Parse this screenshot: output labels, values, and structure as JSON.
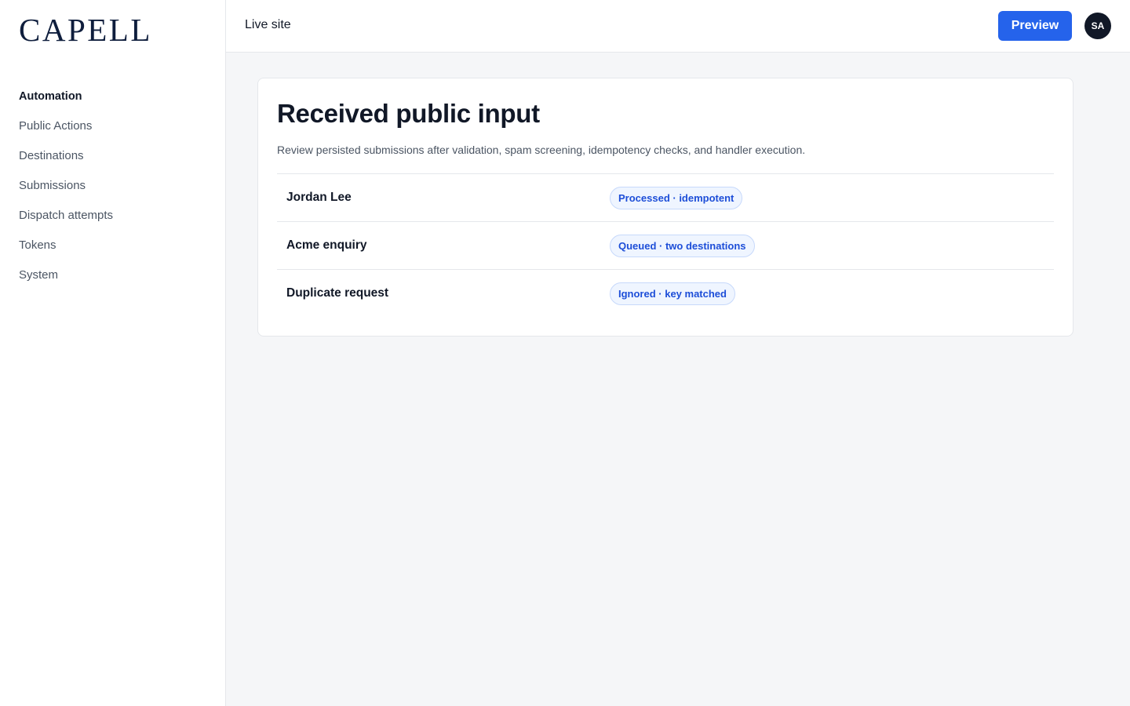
{
  "brand": {
    "logo_text": "CAPELL",
    "colors": {
      "logo": "#0f1e3d",
      "accent": "#2563eb"
    }
  },
  "sidebar": {
    "items": [
      {
        "label": "Automation",
        "active": true
      },
      {
        "label": "Public Actions"
      },
      {
        "label": "Destinations"
      },
      {
        "label": "Submissions"
      },
      {
        "label": "Dispatch attempts"
      },
      {
        "label": "Tokens"
      },
      {
        "label": "System"
      }
    ]
  },
  "topbar": {
    "live_site_label": "Live site",
    "preview_label": "Preview",
    "avatar_initials": "SA"
  },
  "card": {
    "title": "Received public input",
    "description": "Review persisted submissions after validation, spam screening, idempotency checks, and handler execution.",
    "rows": [
      {
        "name": "Jordan Lee",
        "status": "Processed · idempotent"
      },
      {
        "name": "Acme enquiry",
        "status": "Queued · two destinations"
      },
      {
        "name": "Duplicate request",
        "status": "Ignored · key matched"
      }
    ]
  }
}
